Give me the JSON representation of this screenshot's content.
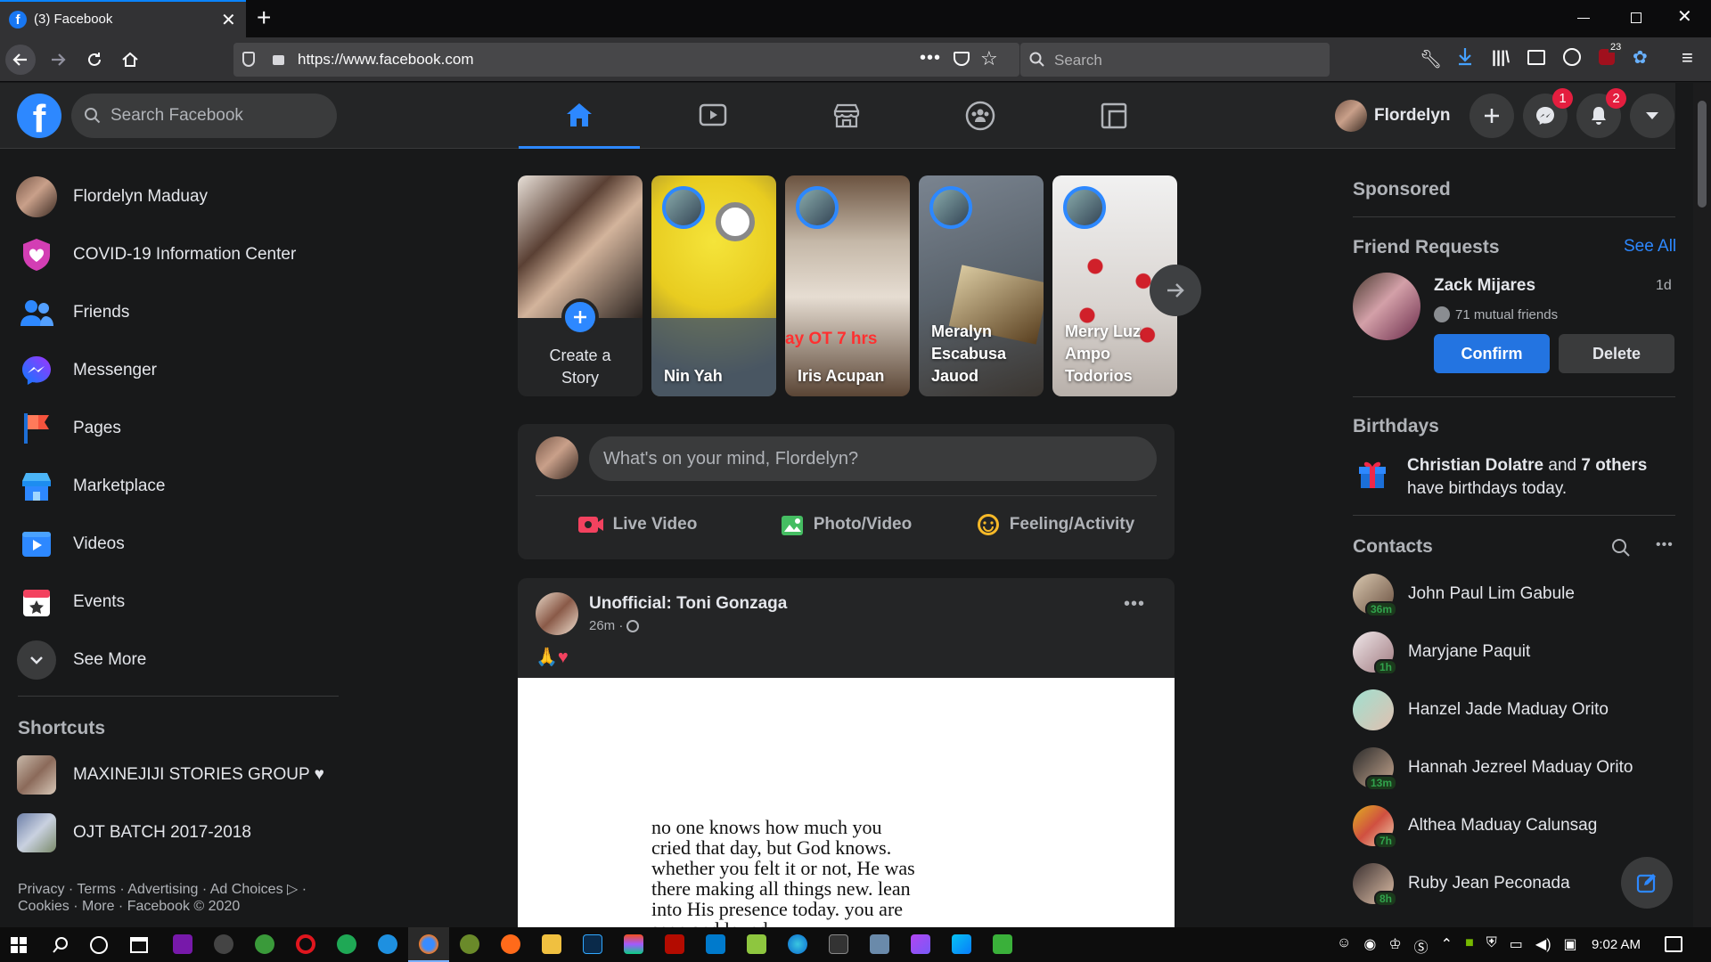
{
  "browser": {
    "tab_title": "(3) Facebook",
    "url": "https://www.facebook.com",
    "search_placeholder": "Search",
    "library_badge": "23"
  },
  "header": {
    "search_placeholder": "Search Facebook",
    "user_name": "Flordelyn",
    "messenger_badge": "1",
    "notifications_badge": "2"
  },
  "left_nav": {
    "items": [
      {
        "label": "Flordelyn Maduay"
      },
      {
        "label": "COVID-19 Information Center"
      },
      {
        "label": "Friends"
      },
      {
        "label": "Messenger"
      },
      {
        "label": "Pages"
      },
      {
        "label": "Marketplace"
      },
      {
        "label": "Videos"
      },
      {
        "label": "Events"
      },
      {
        "label": "See More"
      }
    ],
    "shortcuts_title": "Shortcuts",
    "shortcuts": [
      {
        "label": "MAXINEJIJI STORIES GROUP ♥"
      },
      {
        "label": "OJT BATCH 2017-2018"
      }
    ],
    "footer_line1": "Privacy · Terms · Advertising · Ad Choices ▷ ·",
    "footer_line2": "Cookies · More · Facebook © 2020"
  },
  "stories": {
    "create_label": "Create a Story",
    "items": [
      {
        "name": "Nin Yah"
      },
      {
        "name": "Iris Acupan",
        "overlay": "ay OT 7 hrs"
      },
      {
        "name": "Meralyn Escabusa Jauod"
      },
      {
        "name": "Merry Luz Ampo Todorios"
      }
    ]
  },
  "composer": {
    "placeholder": "What's on your mind, Flordelyn?",
    "live_label": "Live Video",
    "photo_label": "Photo/Video",
    "feeling_label": "Feeling/Activity"
  },
  "post": {
    "author": "Unofficial: Toni Gonzaga",
    "time": "26m ·",
    "caption": "🙏♥",
    "image_lines": [
      "no one knows how much you",
      "cried that day, but God knows.",
      "whether you felt it or not, He was",
      "there making all things new. lean",
      "into His presence today. you are",
      "seen and loved."
    ]
  },
  "right": {
    "sponsored": "Sponsored",
    "friend_requests_title": "Friend Requests",
    "see_all": "See All",
    "request": {
      "name": "Zack Mijares",
      "age": "1d",
      "mutual": "71 mutual friends",
      "confirm": "Confirm",
      "delete": "Delete"
    },
    "birthdays_title": "Birthdays",
    "birthday_name": "Christian Dolatre",
    "birthday_and": " and ",
    "birthday_others": "7 others",
    "birthday_rest": " have birthdays today.",
    "contacts_title": "Contacts",
    "contacts": [
      {
        "name": "John Paul Lim Gabule",
        "time": "36m"
      },
      {
        "name": "Maryjane Paquit",
        "time": "1h"
      },
      {
        "name": "Hanzel Jade Maduay Orito",
        "time": ""
      },
      {
        "name": "Hannah Jezreel Maduay Orito",
        "time": "13m"
      },
      {
        "name": "Althea Maduay Calunsag",
        "time": "7h"
      },
      {
        "name": "Ruby Jean Peconada",
        "time": "8h"
      }
    ]
  },
  "taskbar": {
    "clock": "9:02 AM"
  },
  "colors": {
    "accent": "#2d88ff",
    "surface": "#242526",
    "background": "#18191a"
  }
}
